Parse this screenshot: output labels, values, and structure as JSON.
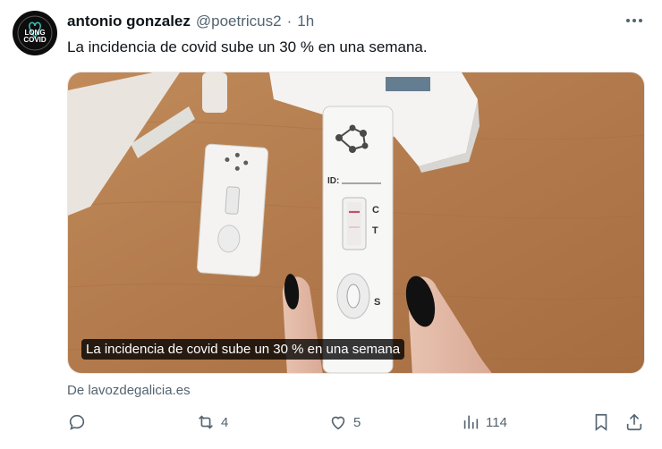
{
  "post": {
    "author": {
      "display_name": "antonio gonzalez",
      "handle": "@poetricus2",
      "separator": "·",
      "time": "1h",
      "avatar_text_top": "LONG",
      "avatar_text_bottom": "COVID"
    },
    "text": "La incidencia de covid sube un 30 % en una semana.",
    "card": {
      "overlay_title": "La incidencia de covid sube un 30 % en una semana",
      "image_alt": "rapid antigen covid test cassette held in a hand",
      "test_labels": {
        "id": "ID:",
        "c": "C",
        "t": "T",
        "s": "S"
      }
    },
    "source_label": "De lavozdegalicia.es",
    "actions": {
      "reply_count": "",
      "repost_count": "4",
      "like_count": "5",
      "views_count": "114"
    }
  },
  "icons": [
    "more-icon",
    "reply-icon",
    "repost-icon",
    "like-icon",
    "views-icon",
    "bookmark-icon",
    "share-icon"
  ],
  "colors": {
    "muted": "#536471",
    "text": "#0f1419",
    "table": "#b27a4c"
  }
}
